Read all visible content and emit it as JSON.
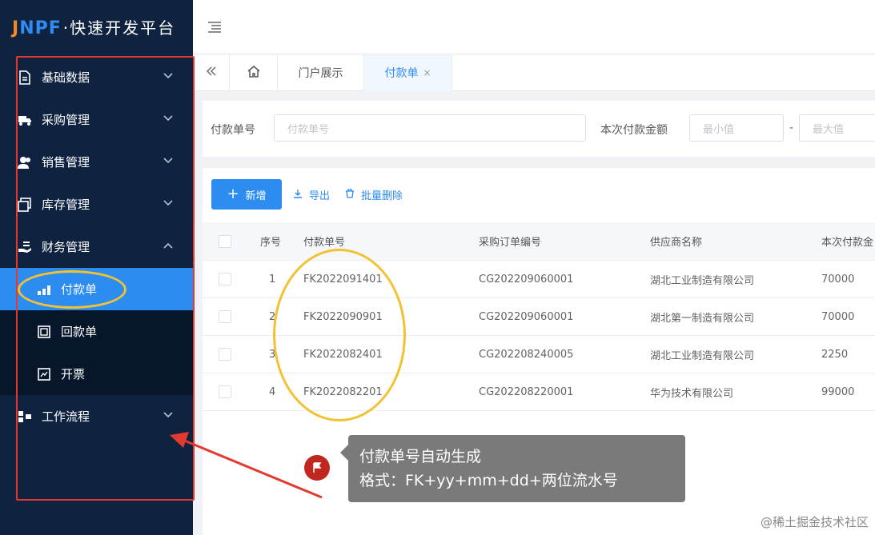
{
  "logo": {
    "letter_j": "J",
    "letters": "NPF",
    "subtitle": "·快速开发平台"
  },
  "sidebar": {
    "items": [
      {
        "label": "基础数据",
        "icon": "document-icon",
        "expanded": false
      },
      {
        "label": "采购管理",
        "icon": "truck-icon",
        "expanded": false
      },
      {
        "label": "销售管理",
        "icon": "users-icon",
        "expanded": false
      },
      {
        "label": "库存管理",
        "icon": "box-icon",
        "expanded": false
      },
      {
        "label": "财务管理",
        "icon": "hand-coin-icon",
        "expanded": true
      }
    ],
    "finance_sub": [
      {
        "label": "付款单",
        "icon": "bar-chart-icon",
        "active": true
      },
      {
        "label": "回款单",
        "icon": "receipt-icon",
        "active": false
      },
      {
        "label": "开票",
        "icon": "invoice-icon",
        "active": false
      }
    ],
    "workflow": {
      "label": "工作流程",
      "icon": "flow-icon",
      "expanded": false
    }
  },
  "tabs": {
    "portal": "门户展示",
    "active": "付款单",
    "close": "×"
  },
  "search": {
    "field1_label": "付款单号",
    "field1_placeholder": "付款单号",
    "field2_label": "本次付款金额",
    "min_placeholder": "最小值",
    "separator": "-",
    "max_placeholder": "最大值"
  },
  "toolbar": {
    "add": "新增",
    "export": "导出",
    "batch_delete": "批量删除"
  },
  "table": {
    "headers": [
      "序号",
      "付款单号",
      "采购订单编号",
      "供应商名称",
      "本次付款金"
    ],
    "rows": [
      [
        "1",
        "FK2022091401",
        "CG202209060001",
        "湖北工业制造有限公司",
        "70000"
      ],
      [
        "2",
        "FK2022090901",
        "CG202209060001",
        "湖北第一制造有限公司",
        "70000"
      ],
      [
        "3",
        "FK2022082401",
        "CG202208240005",
        "湖北工业制造有限公司",
        "2250"
      ],
      [
        "4",
        "FK2022082201",
        "CG202208220001",
        "华为技术有限公司",
        "99000"
      ]
    ]
  },
  "annotation": {
    "line1": "付款单号自动生成",
    "line2": "格式：FK+yy+mm+dd+两位流水号"
  },
  "watermark": "@稀土掘金技术社区",
  "colors": {
    "sidebar_bg": "#0f2240",
    "accent": "#2d8cf0",
    "annotation_red": "#e23a2e",
    "highlight_yellow": "#f2c232"
  }
}
